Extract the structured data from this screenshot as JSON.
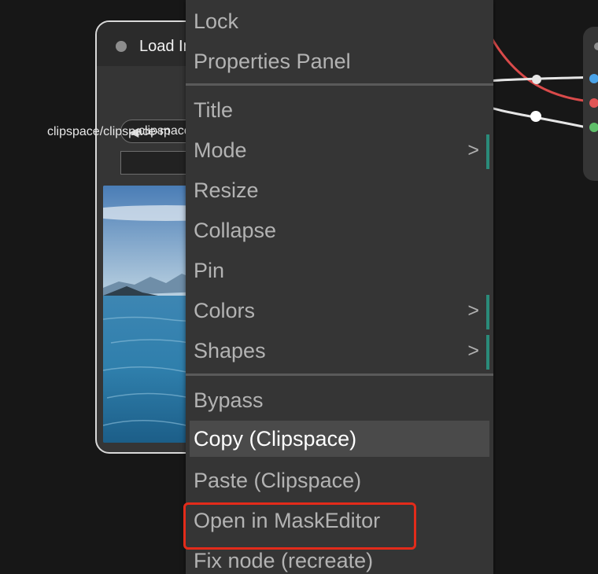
{
  "node": {
    "title": "Load Image",
    "image_combo_value": "clipspace/clipspace-mask-1234567.png",
    "side_label": "clipspace/clipspace-m"
  },
  "context_menu": {
    "items": [
      {
        "label": "Lock"
      },
      {
        "label": "Properties Panel"
      },
      {
        "label": "Title"
      },
      {
        "label": "Mode",
        "submenu": ">"
      },
      {
        "label": "Resize"
      },
      {
        "label": "Collapse"
      },
      {
        "label": "Pin"
      },
      {
        "label": "Colors",
        "submenu": ">"
      },
      {
        "label": "Shapes",
        "submenu": ">"
      },
      {
        "label": "Bypass"
      },
      {
        "label": "Copy (Clipspace)"
      },
      {
        "label": "Paste (Clipspace)"
      },
      {
        "label": "Open in MaskEditor"
      },
      {
        "label": "Fix node (recreate)"
      }
    ],
    "highlighted_item": "Copy (Clipspace)",
    "annotated_item": "Open in MaskEditor"
  },
  "colors": {
    "highlight_border": "#e32b1a",
    "submenu_accent": "#2a8b7a",
    "wire_red": "#d94a4a",
    "slot_blue": "#4aa3e8",
    "slot_red": "#e05555",
    "slot_green": "#5fbf6a"
  }
}
